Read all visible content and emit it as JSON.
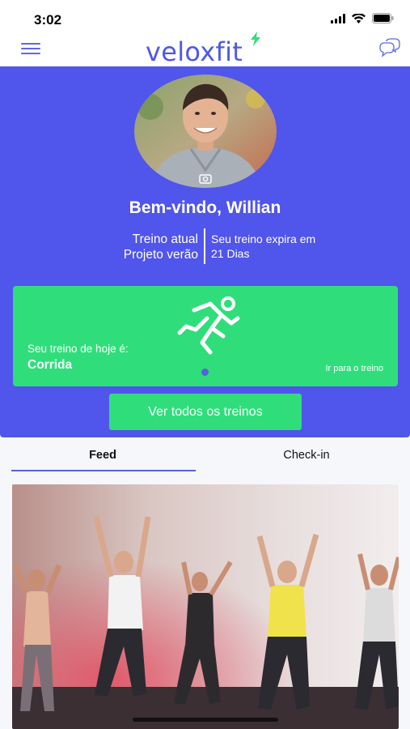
{
  "status": {
    "time": "3:02"
  },
  "header": {
    "logo_text": "veloxfit",
    "menu_icon": "hamburger-menu-icon",
    "chat_icon": "chat-bubbles-icon",
    "brand_color": "#5058e6",
    "bolt_color": "#2fde7b"
  },
  "profile": {
    "welcome": "Bem-vindo, Willian",
    "camera_icon": "camera-icon"
  },
  "plan": {
    "current_label": "Treino atual",
    "current_value": "Projeto verão",
    "expiry_label": "Seu treino expira em",
    "expiry_value": "21 Dias"
  },
  "today": {
    "label": "Seu treino de hoje é:",
    "value": "Corrida",
    "link": "Ir para o treino",
    "icon": "running-person-icon",
    "card_color": "#2fde7b"
  },
  "actions": {
    "view_all": "Ver todos os treinos"
  },
  "tabs": [
    {
      "label": "Feed",
      "active": true
    },
    {
      "label": "Check-in",
      "active": false
    }
  ],
  "colors": {
    "hero_bg": "#5055ec",
    "accent_green": "#2fde7b",
    "tab_indicator": "#5a5fe0"
  }
}
